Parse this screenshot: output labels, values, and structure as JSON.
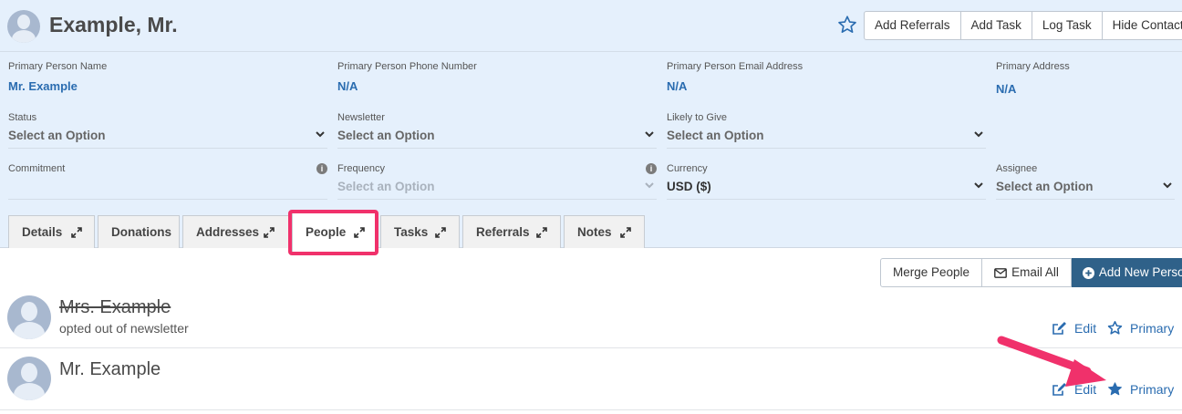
{
  "contact": {
    "name": "Example, Mr.",
    "actions": [
      "Add Referrals",
      "Add Task",
      "Log Task",
      "Hide Contact"
    ]
  },
  "fields": {
    "primary_person_name": {
      "label": "Primary Person Name",
      "value": "Mr. Example"
    },
    "primary_phone": {
      "label": "Primary Person Phone Number",
      "value": "N/A"
    },
    "primary_email": {
      "label": "Primary Person Email Address",
      "value": "N/A"
    },
    "primary_address": {
      "label": "Primary Address",
      "value": "N/A"
    }
  },
  "selects": {
    "status": {
      "label": "Status",
      "value": "Select an Option"
    },
    "newsletter": {
      "label": "Newsletter",
      "value": "Select an Option"
    },
    "likely_to_give": {
      "label": "Likely to Give",
      "value": "Select an Option"
    },
    "commitment": {
      "label": "Commitment",
      "info_icon": "i"
    },
    "frequency": {
      "label": "Frequency",
      "value": "Select an Option",
      "info_icon": "i"
    },
    "currency": {
      "label": "Currency",
      "value": "USD ($)"
    },
    "assignee": {
      "label": "Assignee",
      "value": "Select an Option"
    }
  },
  "tabs": [
    {
      "label": "Details",
      "expandable": true
    },
    {
      "label": "Donations",
      "expandable": false
    },
    {
      "label": "Addresses",
      "expandable": true
    },
    {
      "label": "People",
      "expandable": true,
      "active": true
    },
    {
      "label": "Tasks",
      "expandable": true
    },
    {
      "label": "Referrals",
      "expandable": true
    },
    {
      "label": "Notes",
      "expandable": true
    }
  ],
  "people_actions": {
    "merge": "Merge People",
    "email_all": "Email All",
    "add_new": "Add New Person"
  },
  "people": [
    {
      "name": "Mrs. Example",
      "struck": true,
      "subtitle": "opted out of newsletter",
      "edit": "Edit",
      "primary": "Primary",
      "is_primary": false
    },
    {
      "name": "Mr. Example",
      "struck": false,
      "subtitle": "",
      "edit": "Edit",
      "primary": "Primary",
      "is_primary": true
    }
  ],
  "colors": {
    "header_bg": "#e5f0fc",
    "link": "#2a6cb0",
    "primary_button": "#2f6189",
    "annotation": "#f0316b"
  }
}
